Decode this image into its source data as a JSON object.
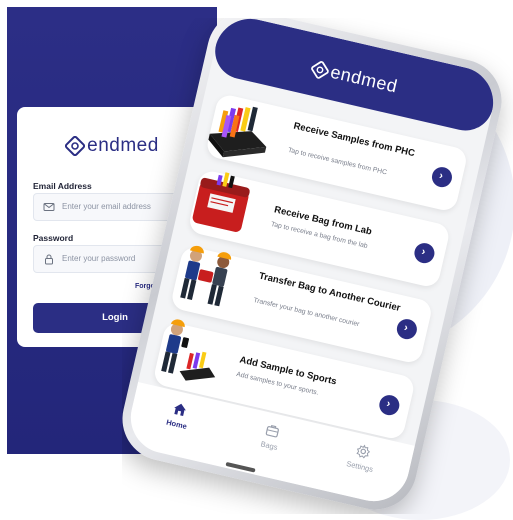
{
  "brand": {
    "name": "endmed",
    "color": "#2b2e84"
  },
  "login": {
    "email_label": "Email Address",
    "email_placeholder": "Enter your email address",
    "password_label": "Password",
    "password_placeholder": "Enter your password",
    "forgot": "Forgot password",
    "button": "Login"
  },
  "app": {
    "cards": [
      {
        "title": "Receive Samples from PHC",
        "subtitle": "Tap to receive samples from PHC",
        "icon": "sample-rack-icon"
      },
      {
        "title": "Receive Bag from Lab",
        "subtitle": "Tap to receive a bag from the lab",
        "icon": "red-bag-icon"
      },
      {
        "title": "Transfer Bag to Another Courier",
        "subtitle": "Transfer your bag to another courier",
        "icon": "courier-handoff-icon"
      },
      {
        "title": "Add Sample to Sports",
        "subtitle": "Add samples to your sports.",
        "icon": "courier-scan-icon"
      }
    ],
    "tabs": [
      {
        "label": "Home",
        "icon": "home-icon",
        "active": true
      },
      {
        "label": "Bags",
        "icon": "bag-icon",
        "active": false
      },
      {
        "label": "Settings",
        "icon": "gear-icon",
        "active": false
      }
    ],
    "go_glyph": "›"
  }
}
